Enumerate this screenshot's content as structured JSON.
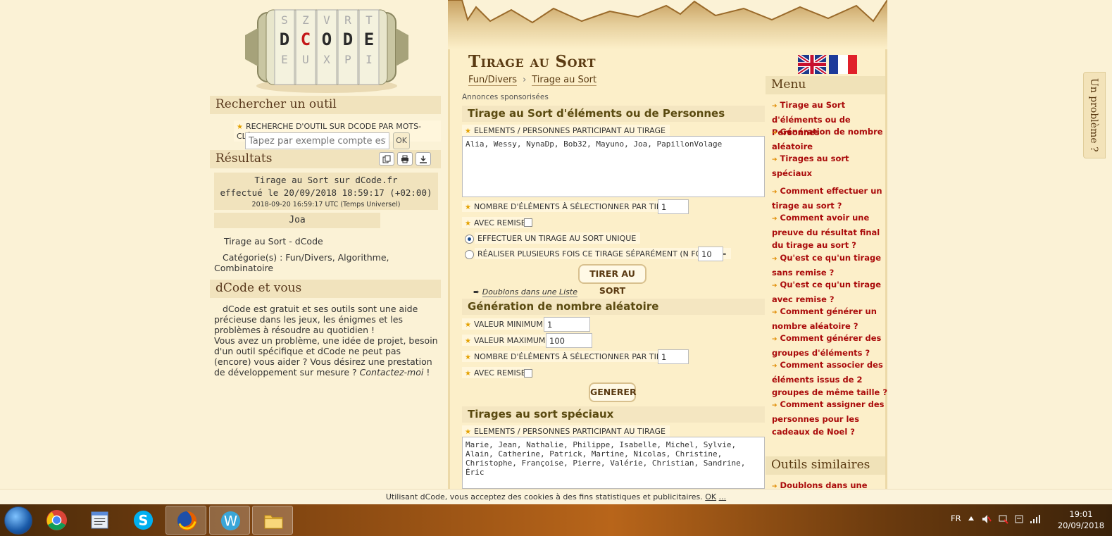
{
  "left": {
    "logo_letters": "DCODE",
    "search": {
      "heading": "Rechercher un outil",
      "label": "RECHERCHE D'OUTIL SUR DCODE PAR MOTS-CLÉS :",
      "placeholder": "Tapez par exemple compte est b",
      "ok_label": "OK"
    },
    "results": {
      "heading": "Résultats",
      "line1": "Tirage au Sort sur dCode.fr",
      "line2": "effectué le 20/09/2018 18:59:17 (+02:00)",
      "line3": "2018-09-20 16:59:17 UTC (Temps Universel)",
      "value": "Joa",
      "title_prefix": "Tirage au Sort - ",
      "title_link": "dCode",
      "categories": "Catégorie(s) : Fun/Divers, Algorithme, Combinatoire"
    },
    "about": {
      "heading": "dCode et vous",
      "p1": "dCode est gratuit et ses outils sont une aide précieuse dans les jeux, les énigmes et les problèmes à résoudre au quotidien !",
      "p2": "Vous avez un problème, une idée de projet, besoin d'un outil spécifique et dCode ne peut pas (encore) vous aider ? Vous désirez une prestation de développement sur mesure ? ",
      "contact": "Contactez-moi",
      "end": " !"
    }
  },
  "main": {
    "title": "Tirage au Sort",
    "breadcrumb": [
      "Fun/Divers",
      "Tirage au Sort"
    ],
    "breadcrumb_sep": "›",
    "ads": "Annonces sponsorisées",
    "section1": {
      "heading": "Tirage au Sort d'éléments ou de Personnes",
      "elements_label": "ELEMENTS / PERSONNES PARTICIPANT AU TIRAGE",
      "elements_value": "Alia, Wessy, NynaDp, Bob32, Mayuno, Joa, PapillonVolage",
      "count_label": "NOMBRE D'ÉLÉMENTS À SÉLECTIONNER PAR TIRAGE",
      "count_value": "1",
      "remise_label": "AVEC REMISE",
      "opt_unique": "EFFECTUER UN TIRAGE AU SORT UNIQUE",
      "opt_multi": "RÉALISER PLUSIEURS FOIS CE TIRAGE SÉPARÉMENT (N FOIS) N=",
      "n_value": "10",
      "button": "TIRER AU SORT",
      "doublons": "Doublons dans une Liste"
    },
    "section2": {
      "heading": "Génération de nombre aléatoire",
      "min_label": "VALEUR MINIMUM",
      "min_value": "1",
      "max_label": "VALEUR MAXIMUM",
      "max_value": "100",
      "count_label": "NOMBRE D'ÉLÉMENTS À SÉLECTIONNER PAR TIRAGE",
      "count_value": "1",
      "remise_label": "AVEC REMISE",
      "button": "GENERER"
    },
    "section3": {
      "heading": "Tirages au sort spéciaux",
      "elements_label": "ELEMENTS / PERSONNES PARTICIPANT AU TIRAGE",
      "elements_value": "Marie, Jean, Nathalie, Philippe, Isabelle, Michel, Sylvie,\nAlain, Catherine, Patrick, Martine, Nicolas, Christine,\nChristophe, Françoise, Pierre, Valérie, Christian, Sandrine,\nÉric"
    }
  },
  "menu": {
    "heading": "Menu",
    "items": [
      "Tirage au Sort d'éléments ou de Personnes",
      "Génération de nombre aléatoire",
      "Tirages au sort spéciaux"
    ],
    "faq": [
      "Comment effectuer un tirage au sort ?",
      "Comment avoir une preuve du résultat final du tirage au sort ?",
      "Qu'est ce qu'un tirage sans remise ?",
      "Qu'est ce qu'un tirage avec remise ?",
      "Comment générer un nombre aléatoire ?",
      "Comment générer des groupes d'éléments ?",
      "Comment associer des éléments issus de 2 groupes de même taille ?",
      "Comment assigner des personnes pour les cadeaux de Noel ?"
    ],
    "similar_heading": "Outils similaires",
    "similar": [
      "Doublons dans une Liste"
    ]
  },
  "side_tab": "Un problème ?",
  "cookie": {
    "text": "Utilisant dCode, vous acceptez des cookies à des fins statistiques et publicitaires. ",
    "ok": "OK",
    "more": "..."
  },
  "taskbar": {
    "apps": [
      "chrome-icon",
      "notepad-icon",
      "skype-icon",
      "firefox-icon",
      "writer-icon",
      "explorer-icon"
    ],
    "lang": "FR",
    "time": "19:01",
    "date": "20/09/2018"
  },
  "colors": {
    "background": "#fbf2d6",
    "menu_link": "#aa0b0b",
    "heading": "#5a3a12"
  }
}
